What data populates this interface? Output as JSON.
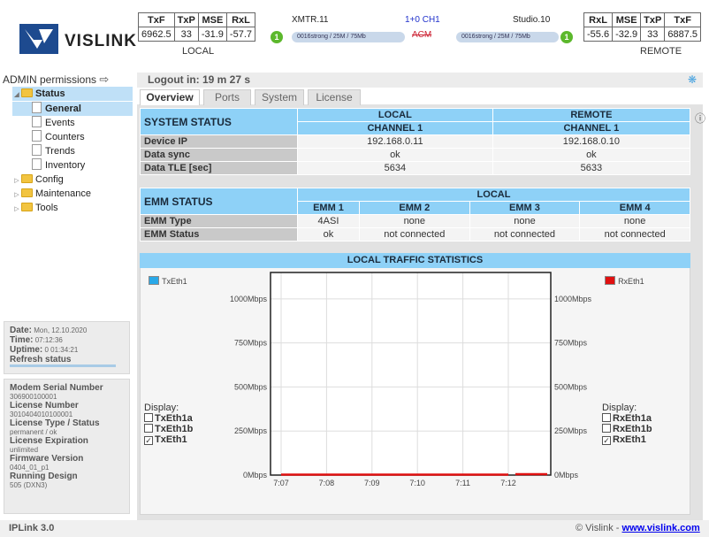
{
  "brand": {
    "name": "VISLINK"
  },
  "local_metrics": {
    "headers": [
      "TxF",
      "TxP",
      "MSE",
      "RxL"
    ],
    "values": [
      "6962.5",
      "33",
      "-31.9",
      "-57.7"
    ],
    "label": "LOCAL"
  },
  "remote_metrics": {
    "headers": [
      "RxL",
      "MSE",
      "TxP",
      "TxF"
    ],
    "values": [
      "-55.6",
      "-32.9",
      "33",
      "6887.5"
    ],
    "label": "REMOTE"
  },
  "link": {
    "left_name": "XMTR.11",
    "center": "1+0 CH1",
    "right_name": "Studio.10",
    "left_bar": "0016strong / 25M / 75Mb",
    "center_status": "ACM",
    "right_bar": "0016strong / 25M / 75Mb",
    "left_badge": "1",
    "right_badge": "1"
  },
  "admin": {
    "label": "ADMIN permissions"
  },
  "tree": [
    {
      "label": "Status"
    },
    {
      "label": "General"
    },
    {
      "label": "Events"
    },
    {
      "label": "Counters"
    },
    {
      "label": "Trends"
    },
    {
      "label": "Inventory"
    },
    {
      "label": "Config"
    },
    {
      "label": "Maintenance"
    },
    {
      "label": "Tools"
    }
  ],
  "datetime": {
    "date_label": "Date:",
    "date": "Mon, 12.10.2020",
    "time_label": "Time:",
    "time": "07:12:36",
    "uptime_label": "Uptime:",
    "uptime": "0 01:34:21",
    "refresh": "Refresh status"
  },
  "device_info": {
    "modem_serial_label": "Modem Serial Number",
    "modem_serial": "306900100001",
    "license_number_label": "License Number",
    "license_number": "3010404010100001",
    "license_type_label": "License Type / Status",
    "license_type": "permanent / ok",
    "license_exp_label": "License Expiration",
    "license_exp": "unlimited",
    "firmware_label": "Firmware Version",
    "firmware": "0404_01_p1",
    "running_label": "Running Design",
    "running": "505 (DXN3)"
  },
  "logout": "Logout in: 19 m 27 s",
  "tabs": [
    "Overview",
    "Ports",
    "System",
    "License"
  ],
  "system_status": {
    "title": "SYSTEM STATUS",
    "local_head": "LOCAL",
    "local_sub": "CHANNEL 1",
    "remote_head": "REMOTE",
    "remote_sub": "CHANNEL 1",
    "rows": [
      {
        "label": "Device IP",
        "local": "192.168.0.11",
        "remote": "192.168.0.10"
      },
      {
        "label": "Data sync",
        "local": "ok",
        "remote": "ok"
      },
      {
        "label": "Data TLE [sec]",
        "local": "5634",
        "remote": "5633"
      }
    ]
  },
  "emm_status": {
    "title": "EMM STATUS",
    "group": "LOCAL",
    "cols": [
      "EMM 1",
      "EMM 2",
      "EMM 3",
      "EMM 4"
    ],
    "rows": [
      {
        "label": "EMM Type",
        "vals": [
          "4ASI",
          "none",
          "none",
          "none"
        ]
      },
      {
        "label": "EMM Status",
        "vals": [
          "ok",
          "not connected",
          "not connected",
          "not connected"
        ]
      }
    ]
  },
  "chart_data": {
    "type": "line",
    "title": "LOCAL TRAFFIC STATISTICS",
    "x": [
      "7:07",
      "7:08",
      "7:09",
      "7:10",
      "7:11",
      "7:12"
    ],
    "y_ticks": [
      "1000Mbps",
      "750Mbps",
      "500Mbps",
      "250Mbps",
      "0Mbps"
    ],
    "ylim": [
      0,
      1150
    ],
    "series": [
      {
        "name": "TxEth1",
        "color": "#29a8e8",
        "values": [
          0,
          0,
          0,
          0,
          0,
          0
        ]
      },
      {
        "name": "RxEth1",
        "color": "#e01010",
        "values": [
          0,
          0,
          0,
          0,
          0,
          0
        ]
      }
    ],
    "display_left": {
      "label": "Display:",
      "items": [
        {
          "name": "TxEth1a",
          "checked": false
        },
        {
          "name": "TxEth1b",
          "checked": false
        },
        {
          "name": "TxEth1",
          "checked": true
        }
      ]
    },
    "display_right": {
      "label": "Display:",
      "items": [
        {
          "name": "RxEth1a",
          "checked": false
        },
        {
          "name": "RxEth1b",
          "checked": false
        },
        {
          "name": "RxEth1",
          "checked": true
        }
      ]
    },
    "grid": true
  },
  "footer": {
    "version": "IPLink 3.0",
    "copyright": "© Vislink - ",
    "link": "www.vislink.com"
  }
}
